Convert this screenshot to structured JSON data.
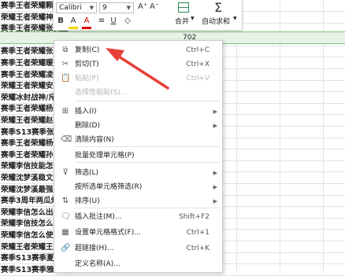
{
  "sheet": {
    "rows": [
      "赛季王者荣耀颗帆怒",
      "荣耀王者荣耀神秘怒",
      "赛季王者荣耀张良直",
      "赛季王者荣耀赵云最强出装听语音",
      "赛季王者荣耀张飞怒",
      "赛季王者荣耀暖怒",
      "赛季王者荣耀凌退怒",
      "荣耀王者荣耀安星怒",
      "荣耀冰封战神/斥天",
      "赛季王者荣耀杨玉环遇见飞",
      "荣耀王者荣耀赵云怒",
      "赛季S13赛季张良最",
      "赛季王者荣耀杨戬最",
      "赛季王者荣耀孙策怒",
      "荣耀李信技能怎么使",
      "荣耀沈梦溪稳文最",
      "荣耀沈梦溪最强出装",
      "赛季3周年两瓜灯怒",
      "荣耀李信怎么出装",
      "荣耀李信技怎么打",
      "荣耀李信怎么使用",
      "荣耀王者荣耀王昭君",
      "赛季S13赛季夏侯惇",
      "赛季S13赛季雅典娜",
      "赛季S13赛季小乔怒",
      "荣耀王者荣耀王昭君",
      "荣耀太乙真人战队"
    ],
    "selected_value": "702"
  },
  "mini_toolbar": {
    "font_name": "Calibri",
    "font_size": "9",
    "grow_font": "A⁺",
    "shrink_font": "A⁻",
    "bold": "B",
    "fill_color": "A",
    "font_color": "A",
    "align": "≡",
    "underline": "U",
    "merge_label": "合并",
    "autosum_label": "自动求和",
    "sigma": "Σ"
  },
  "context_menu": {
    "items": [
      {
        "label": "复制(C)",
        "shortcut": "Ctrl+C",
        "icon": "copy-icon",
        "glyph": "⧉",
        "disabled": false,
        "submenu": false
      },
      {
        "label": "剪切(T)",
        "shortcut": "Ctrl+X",
        "icon": "cut-icon",
        "glyph": "✂",
        "disabled": false,
        "submenu": false
      },
      {
        "label": "粘贴(P)",
        "shortcut": "Ctrl+V",
        "icon": "paste-icon",
        "glyph": "📋",
        "disabled": true,
        "submenu": false
      },
      {
        "label": "选择性粘贴(S)...",
        "shortcut": "",
        "icon": "paste-special-icon",
        "glyph": "",
        "disabled": true,
        "submenu": false
      },
      {
        "label": "插入(I)",
        "shortcut": "",
        "icon": "insert-icon",
        "glyph": "⊞",
        "disabled": false,
        "submenu": true
      },
      {
        "label": "删除(D)",
        "shortcut": "",
        "icon": "delete-icon",
        "glyph": "",
        "disabled": false,
        "submenu": true
      },
      {
        "label": "清除内容(N)",
        "shortcut": "",
        "icon": "clear-icon",
        "glyph": "⌫",
        "disabled": false,
        "submenu": false
      },
      {
        "label": "批量处理单元格(P)",
        "shortcut": "",
        "icon": "batch-icon",
        "glyph": "",
        "disabled": false,
        "submenu": false
      },
      {
        "label": "筛选(L)",
        "shortcut": "",
        "icon": "filter-icon",
        "glyph": "⊽",
        "disabled": false,
        "submenu": true
      },
      {
        "label": "按所选单元格筛选(R)",
        "shortcut": "",
        "icon": "filter-selected-icon",
        "glyph": "",
        "disabled": false,
        "submenu": true
      },
      {
        "label": "排序(U)",
        "shortcut": "",
        "icon": "sort-icon",
        "glyph": "⇅",
        "disabled": false,
        "submenu": true
      },
      {
        "label": "插入批注(M)...",
        "shortcut": "Shift+F2",
        "icon": "comment-icon",
        "glyph": "🗨",
        "disabled": false,
        "submenu": false
      },
      {
        "label": "设置单元格格式(F)...",
        "shortcut": "Ctrl+1",
        "icon": "format-cells-icon",
        "glyph": "▦",
        "disabled": false,
        "submenu": false
      },
      {
        "label": "超链接(H)...",
        "shortcut": "Ctrl+K",
        "icon": "hyperlink-icon",
        "glyph": "🔗",
        "disabled": false,
        "submenu": false
      },
      {
        "label": "定义名称(A)...",
        "shortcut": "",
        "icon": "define-name-icon",
        "glyph": "",
        "disabled": false,
        "submenu": false
      }
    ]
  },
  "colors": {
    "selected_row": "#e6f2e6",
    "annotation_arrow": "#e8403a",
    "autosum_icon": "#2e8b57"
  }
}
